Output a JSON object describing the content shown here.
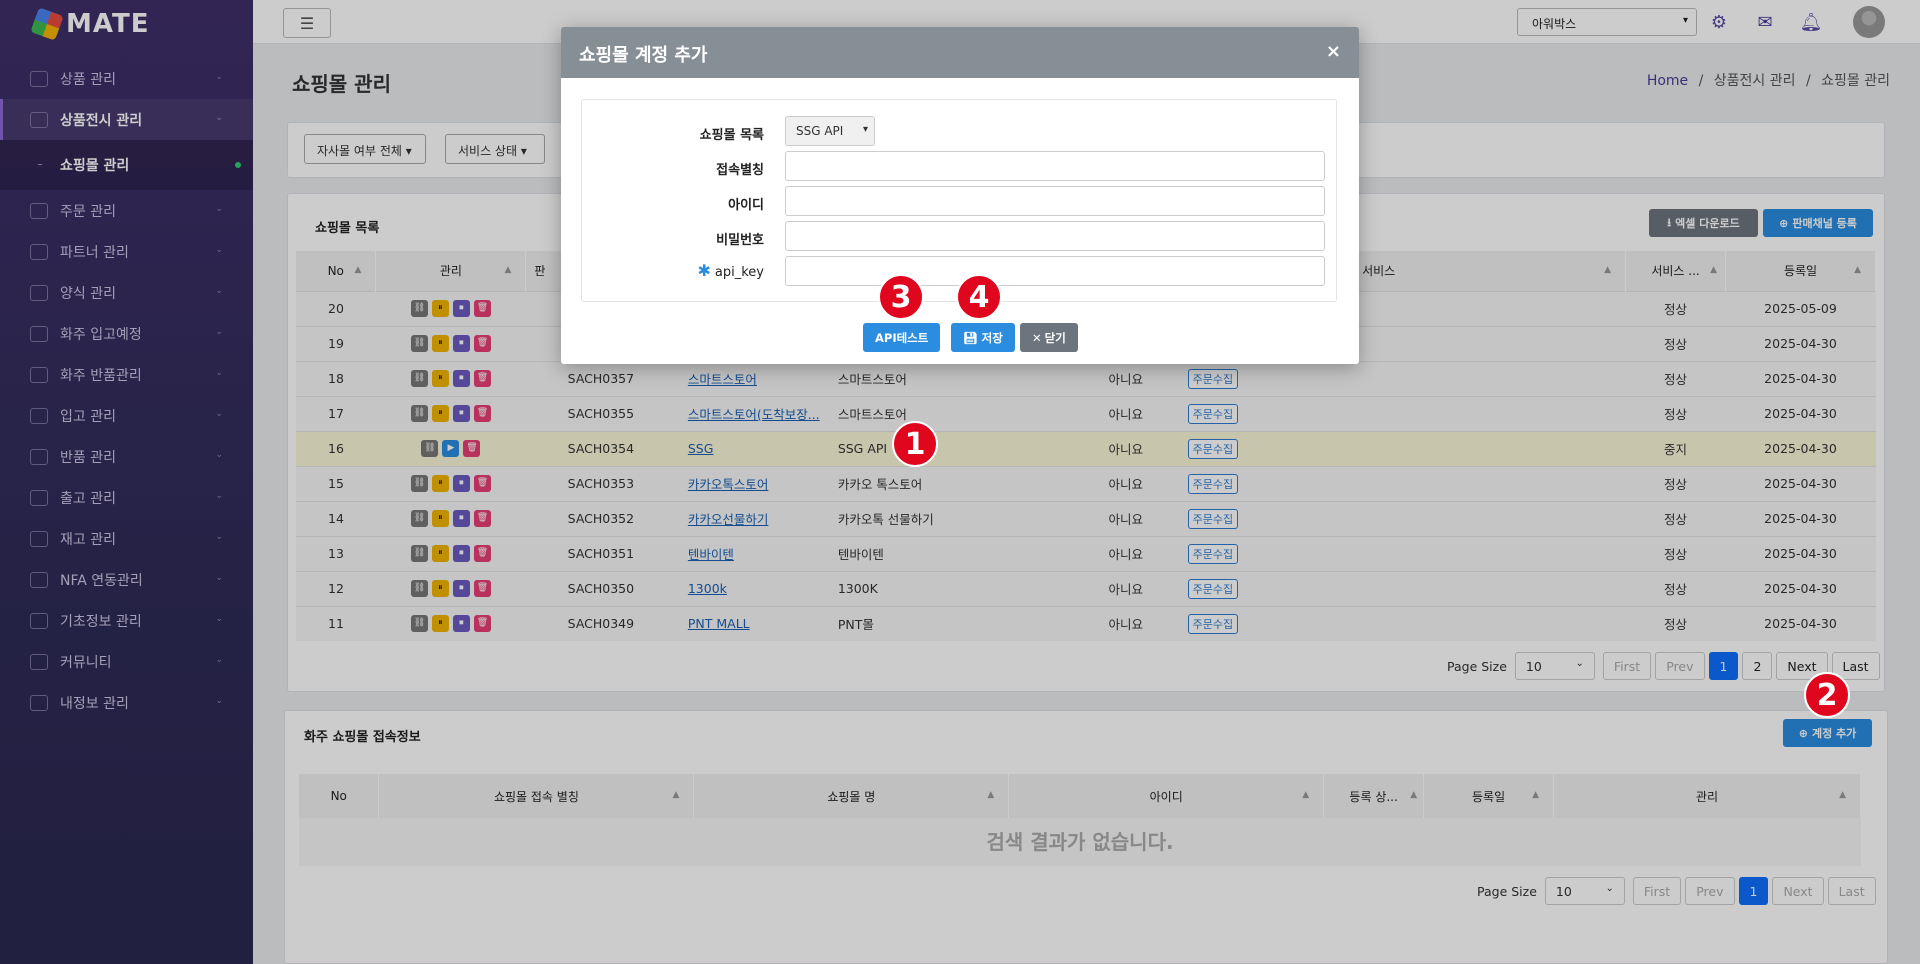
{
  "app": {
    "logo": "MATE"
  },
  "sidebar": {
    "items": [
      {
        "label": "상품 관리"
      },
      {
        "label": "상품전시 관리"
      },
      {
        "label": "쇼핑몰 관리"
      },
      {
        "label": "주문 관리"
      },
      {
        "label": "파트너 관리"
      },
      {
        "label": "양식 관리"
      },
      {
        "label": "화주 입고예정"
      },
      {
        "label": "화주 반품관리"
      },
      {
        "label": "입고 관리"
      },
      {
        "label": "반품 관리"
      },
      {
        "label": "출고 관리"
      },
      {
        "label": "재고 관리"
      },
      {
        "label": "NFA 연동관리"
      },
      {
        "label": "기초정보 관리"
      },
      {
        "label": "커뮤니티"
      },
      {
        "label": "내정보 관리"
      }
    ]
  },
  "topbar": {
    "company_select": "아워박스"
  },
  "page": {
    "title": "쇼핑몰 관리",
    "breadcrumb": {
      "home": "Home",
      "sep": "/",
      "level1": "상품전시 관리",
      "level2": "쇼핑몰 관리"
    }
  },
  "filters": {
    "own_mall": "자사몰 여부 전체",
    "service_status": "서비스 상태"
  },
  "mall_list": {
    "title": "쇼핑몰 목록",
    "excel_button": "엑셀 다운로드",
    "register_button": "판매채널 등록",
    "columns": [
      "No",
      "관리",
      "판",
      "지원 서비스",
      "서비스 ...",
      "등록일"
    ],
    "rows": [
      {
        "no": "20",
        "code": "",
        "name": "",
        "type": "",
        "own": "",
        "svc": "",
        "status": "정상",
        "date": "2025-05-09"
      },
      {
        "no": "19",
        "code": "",
        "name": "",
        "type": "",
        "own": "",
        "svc": "",
        "status": "정상",
        "date": "2025-04-30"
      },
      {
        "no": "18",
        "code": "SACH0357",
        "name": "스마트스토어",
        "type": "스마트스토어",
        "own": "아니요",
        "svc": "주문수집",
        "status": "정상",
        "date": "2025-04-30"
      },
      {
        "no": "17",
        "code": "SACH0355",
        "name": "스마트스토어(도착보장...",
        "type": "스마트스토어",
        "own": "아니요",
        "svc": "주문수집",
        "status": "정상",
        "date": "2025-04-30"
      },
      {
        "no": "16",
        "code": "SACH0354",
        "name": "SSG",
        "type": "SSG API",
        "own": "아니요",
        "svc": "주문수집",
        "status": "중지",
        "date": "2025-04-30"
      },
      {
        "no": "15",
        "code": "SACH0353",
        "name": "카카오톡스토어",
        "type": "카카오 톡스토어",
        "own": "아니요",
        "svc": "주문수집",
        "status": "정상",
        "date": "2025-04-30"
      },
      {
        "no": "14",
        "code": "SACH0352",
        "name": "카카오선물하기",
        "type": "카카오톡 선물하기",
        "own": "아니요",
        "svc": "주문수집",
        "status": "정상",
        "date": "2025-04-30"
      },
      {
        "no": "13",
        "code": "SACH0351",
        "name": "텐바이텐",
        "type": "텐바이텐",
        "own": "아니요",
        "svc": "주문수집",
        "status": "정상",
        "date": "2025-04-30"
      },
      {
        "no": "12",
        "code": "SACH0350",
        "name": "1300k",
        "type": "1300K",
        "own": "아니요",
        "svc": "주문수집",
        "status": "정상",
        "date": "2025-04-30"
      },
      {
        "no": "11",
        "code": "SACH0349",
        "name": "PNT MALL",
        "type": "PNT몰",
        "own": "아니요",
        "svc": "주문수집",
        "status": "정상",
        "date": "2025-04-30"
      }
    ],
    "pager": {
      "size_label": "Page Size",
      "size": "10",
      "first": "First",
      "prev": "Prev",
      "p1": "1",
      "p2": "2",
      "next": "Next",
      "last": "Last"
    }
  },
  "account_info": {
    "title": "화주 쇼핑몰 접속정보",
    "add_button": "계정 추가",
    "columns": [
      "No",
      "쇼핑몰 접속 별칭",
      "쇼핑몰 명",
      "아이디",
      "등록 상...",
      "등록일",
      "관리"
    ],
    "empty": "검색 결과가 없습니다.",
    "pager": {
      "size_label": "Page Size",
      "size": "10",
      "first": "First",
      "prev": "Prev",
      "p1": "1",
      "next": "Next",
      "last": "Last"
    }
  },
  "modal": {
    "title": "쇼핑몰 계정 추가",
    "close": "×",
    "fields": {
      "mall_label": "쇼핑몰 목록",
      "mall_value": "SSG API",
      "alias_label": "접속별칭",
      "id_label": "아이디",
      "pw_label": "비밀번호",
      "key_label": "api_key"
    },
    "api_test": "API테스트",
    "save": "저장",
    "close_button": "닫기"
  },
  "markers": [
    "1",
    "2",
    "3",
    "4"
  ]
}
